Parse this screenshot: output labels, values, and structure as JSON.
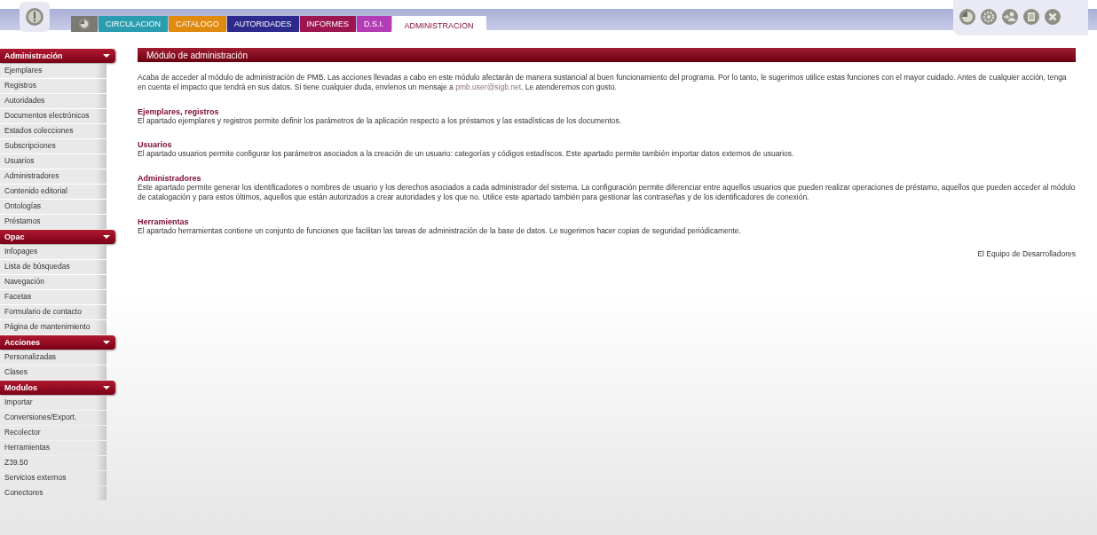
{
  "tabs": [
    {
      "kind": "icon",
      "color": "#7a7a72",
      "selected": false
    },
    {
      "kind": "text",
      "label": "CIRCULACION",
      "color": "#2a9db0",
      "selected": false
    },
    {
      "kind": "text",
      "label": "CATALOGO",
      "color": "#e08a10",
      "selected": false
    },
    {
      "kind": "text",
      "label": "AUTORIDADES",
      "color": "#2c2a8c",
      "selected": false
    },
    {
      "kind": "text",
      "label": "INFORMES",
      "color": "#9c1650",
      "selected": false
    },
    {
      "kind": "text",
      "label": "D.S.I.",
      "color": "#b43cb4",
      "selected": false
    },
    {
      "kind": "text",
      "label": "ADMINISTRACION",
      "color": "#ffffff",
      "selected": true
    }
  ],
  "toolbar": [
    {
      "kind": "clock"
    },
    {
      "kind": "gear"
    },
    {
      "kind": "user"
    },
    {
      "kind": "document"
    },
    {
      "kind": "close"
    }
  ],
  "sidebar": [
    {
      "title": "Administración",
      "items": [
        "Ejemplares",
        "Registros",
        "Autoridades",
        "Documentos electrónicos",
        "Estados colecciones",
        "Subscripciones",
        "Usuarios",
        "Administradores",
        "Contenido editorial",
        "Ontologías",
        "Préstamos"
      ]
    },
    {
      "title": "Opac",
      "items": [
        "Infopages",
        "Lista de búsquedas",
        "Navegación",
        "Facetas",
        "Formulario de contacto",
        "Página de mantenimiento"
      ]
    },
    {
      "title": "Acciones",
      "items": [
        "Personalizadas",
        "Clases"
      ]
    },
    {
      "title": "Modulos",
      "items": [
        "Importar",
        "Conversiones/Export.",
        "Recolector",
        "Herramientas",
        "Z39.50",
        "Servicios externos",
        "Conectores"
      ]
    }
  ],
  "main": {
    "title": "Módulo de administración",
    "intro": {
      "before": "Acaba de acceder al módulo de administración de PMB. Las acciones llevadas a cabo en este módulo afectarán de manera sustancial al buen funcionamiento del programa. Por lo tanto, le sugerimos utilice estas funciones con el mayor cuidado. Antes de cualquier acción, tenga en cuenta el impacto que tendrá en sus datos. Si tiene cualquier duda, envíenos un mensaje a",
      "link": "pmb.user@sigb.net",
      "after": ". Le atenderemos con gusto."
    },
    "sections": [
      {
        "heading": "Ejemplares, registros",
        "text": "El apartado ejemplares y registros permite definir los parámetros de la aplicación respecto a los préstamos y las estadísticas de los documentos."
      },
      {
        "heading": "Usuarios",
        "text": "El apartado usuarios permite configurar los parámetros asociados a la creación de un usuario: categorías y códigos estadíscos. Este apartado permite también importar datos externos de usuarios."
      },
      {
        "heading": "Administradores",
        "text": "Este apartado permite generar los identificadores o nombres de usuario y los derechos asociados a cada administrador del sistema. La configuración permite diferenciar entre aquellos usuarios que pueden realizar operaciones de préstamo, aquellos que pueden acceder al módulo de catalogación y para estos últimos, aquellos que están autorizados a crear autoridades y los que no. Utilice este apartado también para gestionar las contraseñas y de los identificadores de conexión."
      },
      {
        "heading": "Herramientas",
        "text": "El apartado herramientas contiene un conjunto de funciones que facilitan las tareas de administración de la base de datos. Le sugerimos hacer copias de seguridad periódicamente."
      }
    ],
    "signature": "El Equipo de Desarrolladores"
  }
}
